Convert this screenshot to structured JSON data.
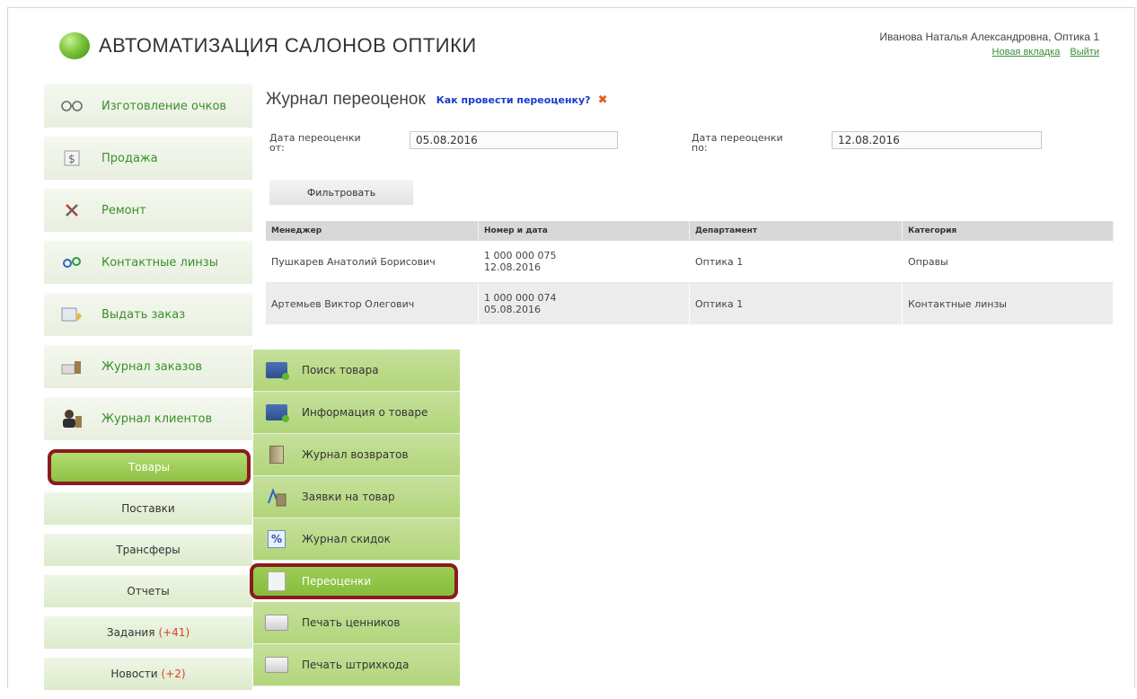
{
  "header": {
    "app_title": "АВТОМАТИЗАЦИЯ САЛОНОВ ОПТИКИ",
    "user": "Иванова Наталья Александровна, Оптика 1",
    "new_tab_link": "Новая вкладка",
    "logout_link": "Выйти"
  },
  "sidebar": {
    "items": [
      {
        "label": "Изготовление очков",
        "icon": "glasses-icon"
      },
      {
        "label": "Продажа",
        "icon": "dollar-icon"
      },
      {
        "label": "Ремонт",
        "icon": "tools-icon"
      },
      {
        "label": "Контактные линзы",
        "icon": "lens-icon"
      },
      {
        "label": "Выдать заказ",
        "icon": "order-icon"
      },
      {
        "label": "Журнал заказов",
        "icon": "journal-icon"
      },
      {
        "label": "Журнал клиентов",
        "icon": "clients-icon"
      }
    ],
    "sub": [
      {
        "label": "Товары",
        "count": ""
      },
      {
        "label": "Поставки",
        "count": ""
      },
      {
        "label": "Трансферы",
        "count": ""
      },
      {
        "label": "Отчеты",
        "count": ""
      },
      {
        "label": "Задания",
        "count": "(+41)"
      },
      {
        "label": "Новости",
        "count": "(+2)"
      }
    ]
  },
  "main": {
    "title": "Журнал переоценок",
    "help_link": "Как провести переоценку?",
    "close_symbol": "✖",
    "filter": {
      "from_label": "Дата переоценки от:",
      "from_value": "05.08.2016",
      "to_label": "Дата переоценки по:",
      "to_value": "12.08.2016",
      "button": "Фильтровать"
    },
    "table": {
      "columns": [
        "Менеджер",
        "Номер и дата",
        "Департамент",
        "Категория"
      ],
      "rows": [
        {
          "manager": "Пушкарев Анатолий Борисович",
          "number": "1 000 000 075",
          "date": "12.08.2016",
          "department": "Оптика 1",
          "category": "Оправы"
        },
        {
          "manager": "Артемьев Виктор Олегович",
          "number": "1 000 000 074",
          "date": "05.08.2016",
          "department": "Оптика 1",
          "category": "Контактные линзы"
        }
      ]
    }
  },
  "submenu": {
    "items": [
      {
        "label": "Поиск товара"
      },
      {
        "label": "Информация о товаре"
      },
      {
        "label": "Журнал возвратов"
      },
      {
        "label": "Заявки на товар"
      },
      {
        "label": "Журнал скидок"
      },
      {
        "label": "Переоценки"
      },
      {
        "label": "Печать ценников"
      },
      {
        "label": "Печать штрихкода"
      }
    ]
  },
  "colors": {
    "accent_green": "#3a8f2a",
    "highlight_border": "#8b1b1e",
    "link_blue": "#1a3ad0",
    "count_red": "#e03a2a"
  }
}
